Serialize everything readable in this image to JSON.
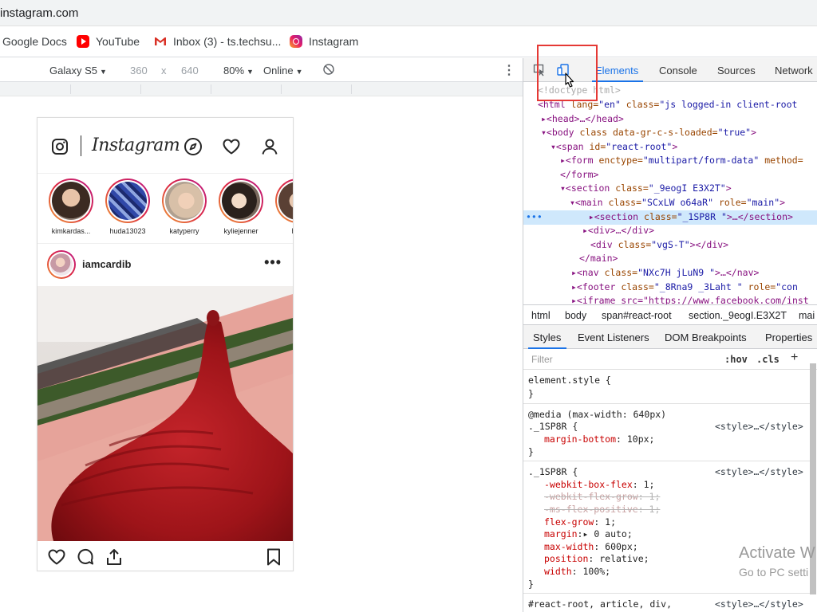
{
  "browser": {
    "url": "instagram.com",
    "bookmarks": [
      {
        "label": "Google Docs",
        "icon": "none"
      },
      {
        "label": "YouTube",
        "icon": "youtube-icon"
      },
      {
        "label": "Inbox (3) - ts.techsu...",
        "icon": "gmail-icon"
      },
      {
        "label": "Instagram",
        "icon": "instagram-icon"
      }
    ]
  },
  "device_toolbar": {
    "device": "Galaxy S5",
    "width": "360",
    "times": "x",
    "height": "640",
    "zoom": "80%",
    "network": "Online"
  },
  "instagram": {
    "logo": "Instagram",
    "stories": [
      {
        "name": "kimkardas..."
      },
      {
        "name": "huda13023"
      },
      {
        "name": "katyperry"
      },
      {
        "name": "kyliejenner"
      },
      {
        "name": "hud"
      }
    ],
    "post": {
      "username": "iamcardib",
      "more": "•••"
    }
  },
  "devtools": {
    "tabs": [
      "Elements",
      "Console",
      "Sources",
      "Network"
    ],
    "active_tab": "Elements",
    "dom": {
      "doctype": "<!doctype html>",
      "l1": {
        "tag_open": "<html",
        "a1": " lang=",
        "v1": "\"en\"",
        "a2": " class=",
        "v2": "\"js logged-in client-root "
      },
      "l2": {
        "text": "▸<head>…</head>"
      },
      "l3": {
        "tag": "▾<body",
        "a": " class data-gr-c-s-loaded=",
        "v": "\"true\"",
        "end": ">"
      },
      "l4": {
        "tag": "▾<span",
        "a": " id=",
        "v": "\"react-root\"",
        "end": ">"
      },
      "l5": {
        "tag": "▸<form",
        "a": " enctype=",
        "v": "\"multipart/form-data\"",
        "a2": " method="
      },
      "l6": {
        "text": "</form>"
      },
      "l7": {
        "tag": "▾<section",
        "a": " class=",
        "v": "\"_9eogI E3X2T\"",
        "end": ">"
      },
      "l8": {
        "tag": "▾<main",
        "a": " class=",
        "v": "\"SCxLW  o64aR\"",
        "a2": " role=",
        "v2": "\"main\"",
        "end": ">"
      },
      "l9": {
        "prefix": "•••",
        "tag": "▸<section",
        "a": " class=",
        "v": "\"_1SP8R   \"",
        "end": ">…</section>"
      },
      "l10": {
        "text": "▸<div>…</div>"
      },
      "l11": {
        "tag": "<div",
        "a": " class=",
        "v": "\"vgS-T\"",
        "end": "></div>"
      },
      "l12": {
        "text": "</main>"
      },
      "l13": {
        "tag": "▸<nav",
        "a": " class=",
        "v": "\"NXc7H jLuN9  \"",
        "end": ">…</nav>"
      },
      "l14": {
        "tag": "▸<footer",
        "a": " class=",
        "v": "\"_8Rna9  _3Laht \"",
        "a2": " role=",
        "v2": "\"con"
      },
      "l15": {
        "text": "▸<iframe src=\"https://www.facebook.com/inst"
      }
    },
    "breadcrumbs": [
      "html",
      "body",
      "span#react-root",
      "section._9eogI.E3X2T",
      "mai"
    ],
    "styles_tabs": [
      "Styles",
      "Event Listeners",
      "DOM Breakpoints",
      "Properties"
    ],
    "filter_placeholder": "Filter",
    "hov": ":hov",
    "cls": ".cls",
    "plus": "+",
    "rules": {
      "r1_selector": "element.style {",
      "close": "}",
      "media": "@media (max-width: 640px)",
      "r2_selector": "._1SP8R {",
      "src": "<style>…</style>",
      "r2_prop": "margin-bottom",
      "r2_val": ": 10px;",
      "r3_selector": "._1SP8R {",
      "p1": "-webkit-box-flex",
      "v1": ": 1;",
      "p2": "-webkit-flex-grow",
      "v2": ": 1;",
      "p3": "-ms-flex-positive",
      "v3": ": 1;",
      "p4": "flex-grow",
      "v4": ": 1;",
      "p5": "margin",
      "v5": ":▸ 0 auto;",
      "p6": "max-width",
      "v6": ": 600px;",
      "p7": "position",
      "v7": ": relative;",
      "p8": "width",
      "v8": ": 100%;",
      "r4_selector": "#react-root, article, div,"
    }
  },
  "watermark": {
    "line1": "Activate W",
    "line2": "Go to PC setti"
  },
  "colors": {
    "accent": "#1a73e8",
    "highlight": "#e53935",
    "instagram_ring": "#dc2743"
  }
}
